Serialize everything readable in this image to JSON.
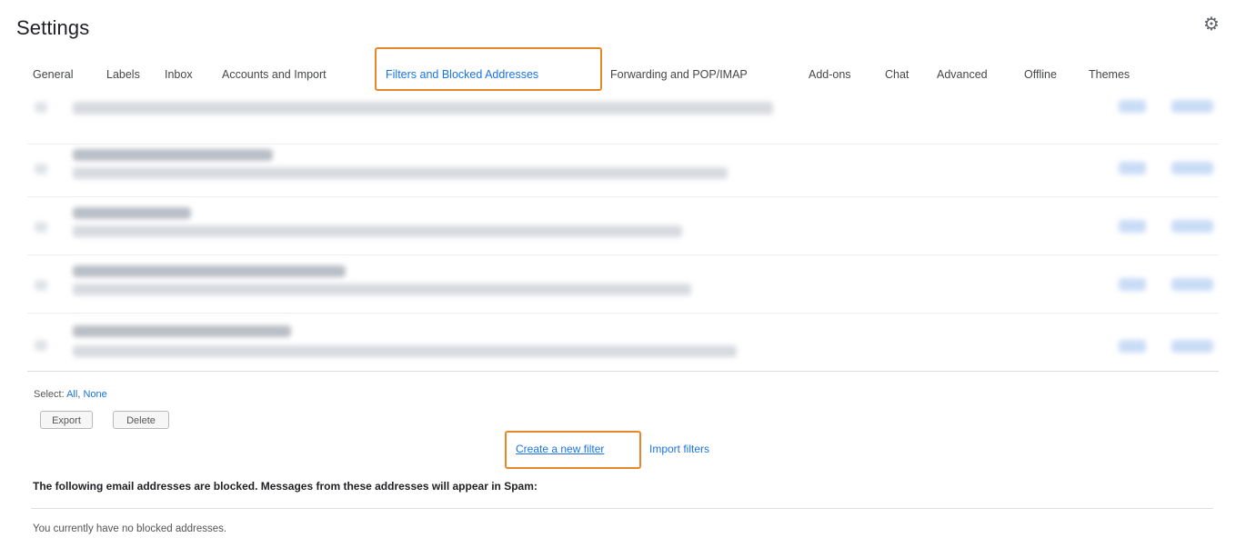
{
  "header": {
    "title": "Settings",
    "gear_icon": "gear-icon"
  },
  "tabs": [
    {
      "label": "General",
      "active": false
    },
    {
      "label": "Labels",
      "active": false
    },
    {
      "label": "Inbox",
      "active": false
    },
    {
      "label": "Accounts and Import",
      "active": false
    },
    {
      "label": "Filters and Blocked Addresses",
      "active": true
    },
    {
      "label": "Forwarding and POP/IMAP",
      "active": false
    },
    {
      "label": "Add-ons",
      "active": false
    },
    {
      "label": "Chat",
      "active": false
    },
    {
      "label": "Advanced",
      "active": false
    },
    {
      "label": "Offline",
      "active": false
    },
    {
      "label": "Themes",
      "active": false
    }
  ],
  "filters": {
    "select_label": "Select:",
    "select_all": "All",
    "select_none": "None",
    "export_label": "Export",
    "delete_label": "Delete",
    "create_filter_label": "Create a new filter",
    "import_filters_label": "Import filters"
  },
  "blocked": {
    "heading": "The following email addresses are blocked. Messages from these addresses will appear in Spam:",
    "empty_message": "You currently have no blocked addresses."
  },
  "colors": {
    "accent": "#1a73e8",
    "highlight": "#e8872a"
  }
}
